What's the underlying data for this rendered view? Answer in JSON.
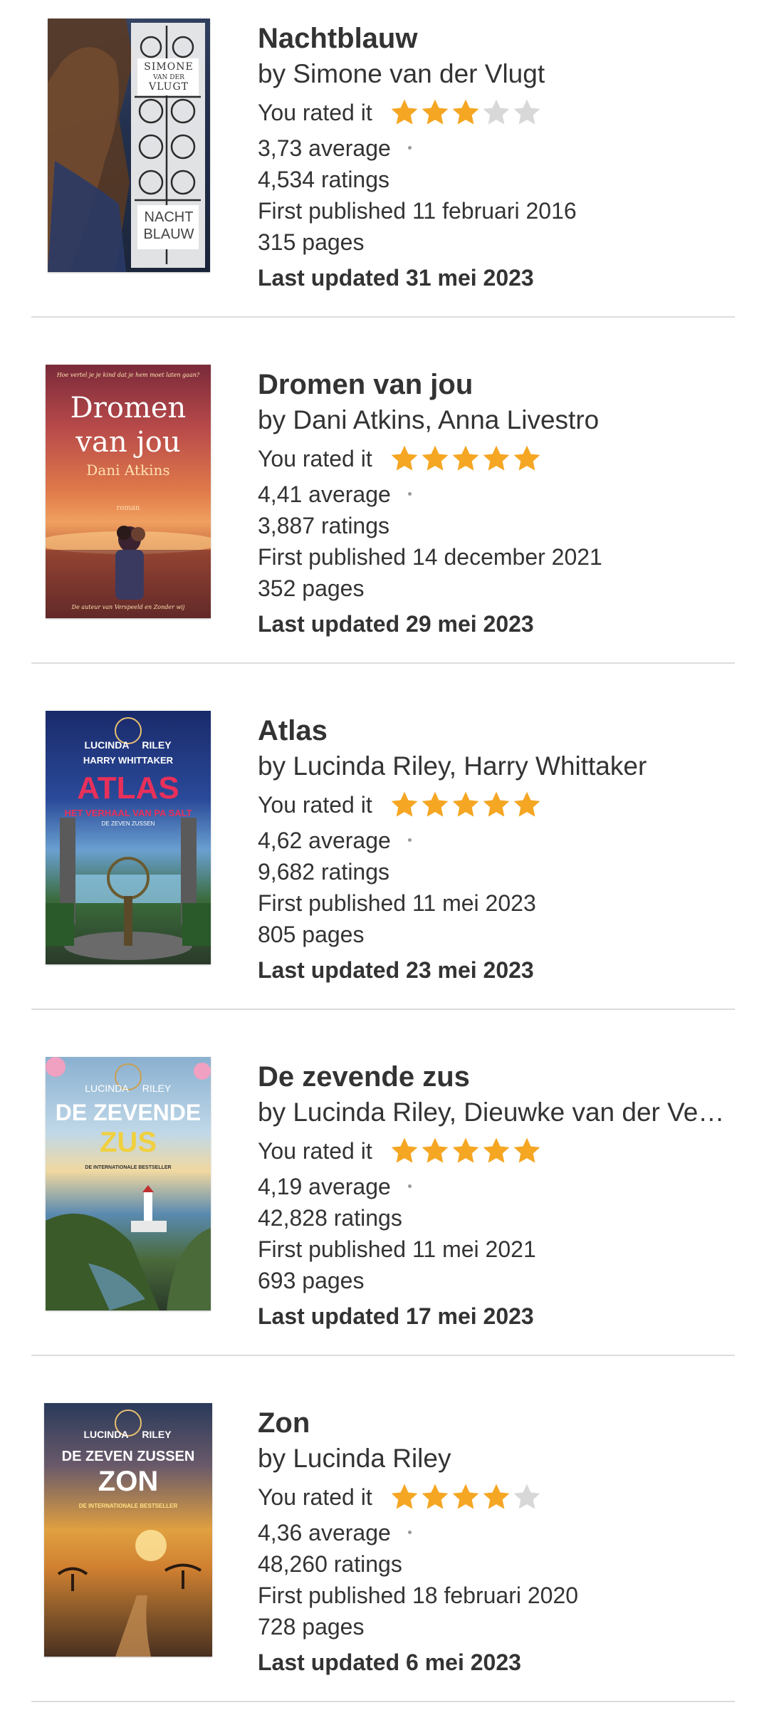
{
  "colors": {
    "star_filled": "#F5A623",
    "star_empty": "#D8D8D8",
    "divider": "#DCDCDC"
  },
  "books": [
    {
      "title": "Nachtblauw",
      "author": "by Simone van der Vlugt",
      "rated_label": "You rated it",
      "user_rating": 3,
      "average": "3,73 average",
      "ratings": "4,534 ratings",
      "first_published": "First published 11 februari 2016",
      "pages": "315 pages",
      "last_updated": "Last updated 31 mei 2023",
      "cover": {
        "lines": [
          "SIMONE",
          "VAN DER",
          "VLUGT",
          "NACHT",
          "BLAUW"
        ]
      }
    },
    {
      "title": "Dromen van jou",
      "author": "by Dani Atkins, Anna Livestro",
      "rated_label": "You rated it",
      "user_rating": 5,
      "average": "4,41 average",
      "ratings": "3,887 ratings",
      "first_published": "First published 14 december 2021",
      "pages": "352 pages",
      "last_updated": "Last updated 29 mei 2023",
      "cover": {
        "tagline": "Hoe vertel je je kind dat je hem moet laten gaan?",
        "lines": [
          "Dromen",
          "van jou",
          "Dani Atkins",
          "roman"
        ],
        "footer": "De auteur van Verspeeld en Zonder wij"
      }
    },
    {
      "title": "Atlas",
      "author": "by Lucinda Riley, Harry Whittaker",
      "rated_label": "You rated it",
      "user_rating": 5,
      "average": "4,62 average",
      "ratings": "9,682 ratings",
      "first_published": "First published 11 mei 2023",
      "pages": "805 pages",
      "last_updated": "Last updated 23 mei 2023",
      "cover": {
        "lines": [
          "LUCINDA",
          "RILEY",
          "HARRY WHITTAKER",
          "ATLAS",
          "HET VERHAAL VAN PA SALT",
          "DE ZEVEN ZUSSEN"
        ]
      }
    },
    {
      "title": "De zevende zus",
      "author": "by Lucinda Riley, Dieuwke van der Ve…",
      "rated_label": "You rated it",
      "user_rating": 5,
      "average": "4,19 average",
      "ratings": "42,828 ratings",
      "first_published": "First published 11 mei 2021",
      "pages": "693 pages",
      "last_updated": "Last updated 17 mei 2023",
      "cover": {
        "lines": [
          "LUCINDA",
          "RILEY",
          "DE ZEVENDE",
          "ZUS",
          "DE INTERNATIONALE BESTSELLER"
        ]
      }
    },
    {
      "title": "Zon",
      "author": "by Lucinda Riley",
      "rated_label": "You rated it",
      "user_rating": 4,
      "average": "4,36 average",
      "ratings": "48,260 ratings",
      "first_published": "First published 18 februari 2020",
      "pages": "728 pages",
      "last_updated": "Last updated 6 mei 2023",
      "cover": {
        "lines": [
          "LUCINDA",
          "RILEY",
          "DE ZEVEN ZUSSEN",
          "ZON",
          "DE INTERNATIONALE BESTSELLER"
        ]
      }
    }
  ]
}
